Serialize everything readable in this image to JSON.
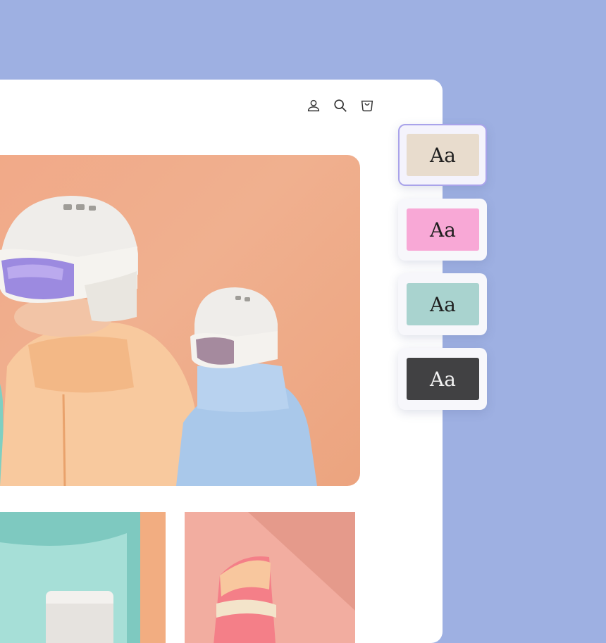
{
  "header": {
    "icons": [
      "account-icon",
      "search-icon",
      "cart-icon"
    ]
  },
  "typography_swatches": [
    {
      "sample": "Aa",
      "bg": "#e8dccd",
      "fg": "#1f1f1f",
      "selected": true
    },
    {
      "sample": "Aa",
      "bg": "#f8a8d6",
      "fg": "#1f1f1f",
      "selected": false
    },
    {
      "sample": "Aa",
      "bg": "#a9d3cf",
      "fg": "#1f1f1f",
      "selected": false
    },
    {
      "sample": "Aa",
      "bg": "#414143",
      "fg": "#f2f2f2",
      "selected": false
    }
  ],
  "colors": {
    "backdrop": "#9eb0e2",
    "selection_border": "#a9a3ea"
  }
}
